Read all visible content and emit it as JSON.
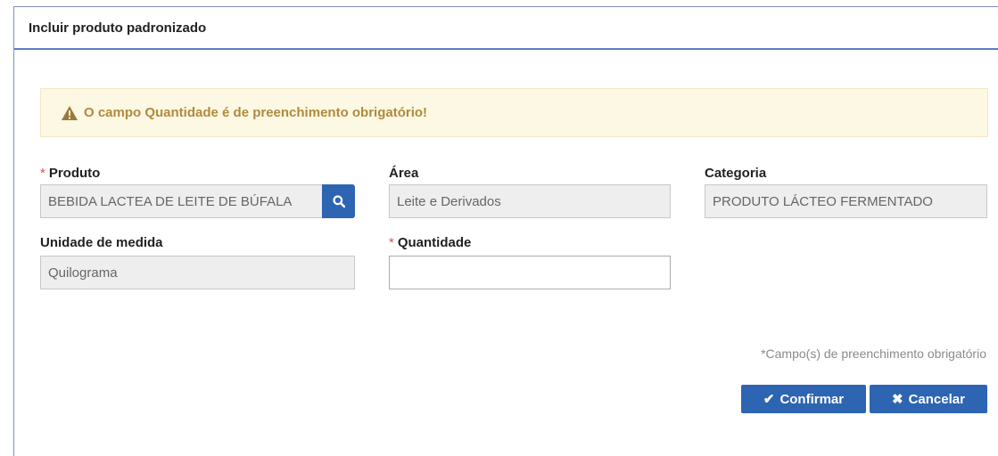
{
  "dialog": {
    "title": "Incluir produto padronizado"
  },
  "alert": {
    "icon": "warning-triangle-icon",
    "message": "O campo Quantidade é de preenchimento obrigatório!"
  },
  "fields": {
    "produto": {
      "required_mark": "*",
      "label": "Produto",
      "value": "BEBIDA LACTEA DE LEITE DE BÚFALA"
    },
    "area": {
      "label": "Área",
      "value": "Leite e Derivados"
    },
    "categoria": {
      "label": "Categoria",
      "value": "PRODUTO LÁCTEO FERMENTADO"
    },
    "unidade": {
      "label": "Unidade de medida",
      "value": "Quilograma"
    },
    "quantidade": {
      "required_mark": "*",
      "label": "Quantidade",
      "value": ""
    }
  },
  "required_note": "*Campo(s) de preenchimento obrigatório",
  "buttons": {
    "confirm": {
      "icon": "check-icon",
      "label": "Confirmar"
    },
    "cancel": {
      "icon": "x-icon",
      "label": "Cancelar"
    }
  },
  "colors": {
    "primary": "#2e65b2",
    "alert_bg": "#fcf8e3",
    "alert_text": "#b08a3e",
    "required": "#d9534f"
  }
}
